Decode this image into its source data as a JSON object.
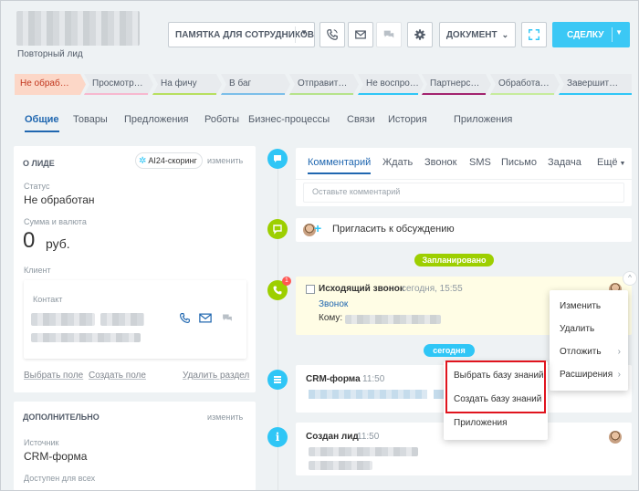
{
  "header": {
    "subtitle": "Повторный лид",
    "memo_button": "ПАМЯТКА ДЛЯ СОТРУДНИКОВ",
    "document_button": "ДОКУМЕНТ",
    "deal_button": "СДЕЛКУ"
  },
  "stages": [
    {
      "label": "Не обраб…",
      "color": "#f97b4f"
    },
    {
      "label": "Просмотр…",
      "color": "#f7b8cf"
    },
    {
      "label": "На фичу",
      "color": "#b7df5f"
    },
    {
      "label": "В баг",
      "color": "#7cbfe9"
    },
    {
      "label": "Отправит…",
      "color": "#b5e38a"
    },
    {
      "label": "Не воспро…",
      "color": "#2fc6f6"
    },
    {
      "label": "Партнерс…",
      "color": "#a3246f"
    },
    {
      "label": "Обработа…",
      "color": "#c6ec9c"
    },
    {
      "label": "Завершит…",
      "color": "#2fc6f6"
    }
  ],
  "tabs": [
    "Общие",
    "Товары",
    "Предложения",
    "Роботы",
    "Бизнес-процессы",
    "Связи",
    "История",
    "Приложения"
  ],
  "about": {
    "header": "О ЛИДЕ",
    "scoring_chip": "AI24-скоринг",
    "edit_link": "изменить",
    "status_label": "Статус",
    "status_value": "Не обработан",
    "sum_label": "Сумма и валюта",
    "sum_value": "0",
    "currency": "руб.",
    "client_label": "Клиент",
    "contact_label": "Контакт",
    "select_field": "Выбрать поле",
    "create_field": "Создать поле",
    "delete_section": "Удалить раздел"
  },
  "extra": {
    "header": "ДОПОЛНИТЕЛЬНО",
    "edit_link": "изменить",
    "source_label": "Источник",
    "source_value": "CRM-форма",
    "access_label": "Доступен для всех"
  },
  "composer": {
    "tabs": [
      "Комментарий",
      "Ждать",
      "Звонок",
      "SMS",
      "Письмо",
      "Задача",
      "Ещё"
    ],
    "placeholder": "Оставьте комментарий"
  },
  "timeline": {
    "invite": "Пригласить к обсуждению",
    "planned_pill": "Запланировано",
    "call_badge": "1",
    "call_title": "Исходящий звонок",
    "call_time": "сегодня, 15:55",
    "call_link": "Звонок",
    "to_label": "Кому:",
    "today_pill": "сегодня",
    "form_title": "CRM-форма",
    "form_time": "11:50",
    "lead_title": "Создан лид",
    "lead_time": "11:50"
  },
  "context_menu": {
    "items": [
      "Изменить",
      "Удалить",
      "Отложить",
      "Расширения"
    ]
  },
  "submenu": {
    "items": [
      "Выбрать базу знаний",
      "Создать базу знаний",
      "Приложения"
    ]
  }
}
